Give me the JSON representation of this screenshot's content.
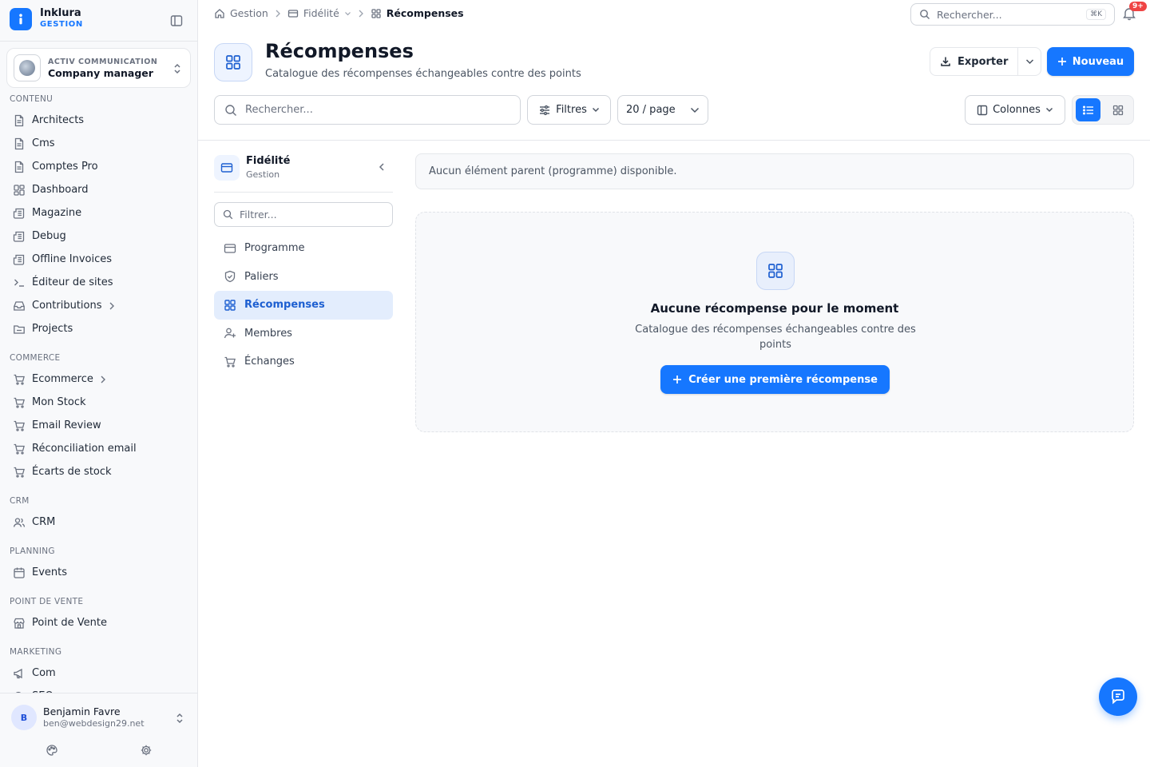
{
  "brand": {
    "name": "Inklura",
    "sub": "GESTION"
  },
  "org": {
    "label": "ACTIV COMMUNICATION",
    "name": "Company manager"
  },
  "sidebar": {
    "sections": [
      {
        "title": "CONTENU",
        "items": [
          {
            "label": "Architects",
            "icon": "file-text-icon"
          },
          {
            "label": "Cms",
            "icon": "file-text-icon"
          },
          {
            "label": "Comptes Pro",
            "icon": "file-text-icon"
          },
          {
            "label": "Dashboard",
            "icon": "dashboard-icon"
          },
          {
            "label": "Magazine",
            "icon": "newspaper-icon"
          },
          {
            "label": "Debug",
            "icon": "newspaper-icon"
          },
          {
            "label": "Offline Invoices",
            "icon": "newspaper-icon"
          },
          {
            "label": "Éditeur de sites",
            "icon": "terminal-icon"
          },
          {
            "label": "Contributions",
            "icon": "inbox-icon",
            "has_children": true
          },
          {
            "label": "Projects",
            "icon": "folder-icon"
          }
        ]
      },
      {
        "title": "COMMERCE",
        "items": [
          {
            "label": "Ecommerce",
            "icon": "cart-icon",
            "has_children": true
          },
          {
            "label": "Mon Stock",
            "icon": "cart-icon"
          },
          {
            "label": "Email Review",
            "icon": "cart-icon"
          },
          {
            "label": "Réconciliation email",
            "icon": "cart-icon"
          },
          {
            "label": "Écarts de stock",
            "icon": "cart-icon"
          }
        ]
      },
      {
        "title": "CRM",
        "items": [
          {
            "label": "CRM",
            "icon": "users-icon"
          }
        ]
      },
      {
        "title": "PLANNING",
        "items": [
          {
            "label": "Events",
            "icon": "calendar-icon"
          }
        ]
      },
      {
        "title": "POINT DE VENTE",
        "items": [
          {
            "label": "Point de Vente",
            "icon": "store-icon"
          }
        ]
      },
      {
        "title": "MARKETING",
        "items": [
          {
            "label": "Com",
            "icon": "megaphone-icon"
          },
          {
            "label": "SEO",
            "icon": "search-icon"
          }
        ]
      }
    ]
  },
  "user": {
    "initial": "B",
    "name": "Benjamin Favre",
    "email": "ben@webdesign29.net"
  },
  "topbar": {
    "breadcrumbs": [
      {
        "label": "Gestion",
        "icon": "home-icon"
      },
      {
        "label": "Fidélité",
        "icon": "card-icon",
        "has_dropdown": true
      },
      {
        "label": "Récompenses",
        "icon": "grid-icon",
        "current": true
      }
    ],
    "search_placeholder": "Rechercher...",
    "search_shortcut": "⌘K",
    "notifications_badge": "9+"
  },
  "page": {
    "title": "Récompenses",
    "subtitle": "Catalogue des récompenses échangeables contre des points",
    "export_label": "Exporter",
    "new_label": "Nouveau"
  },
  "toolbar": {
    "search_placeholder": "Rechercher...",
    "filters_label": "Filtres",
    "per_page_label": "20 / page",
    "columns_label": "Colonnes",
    "view_mode": "list"
  },
  "subnav": {
    "title": "Fidélité",
    "caption": "Gestion",
    "filter_placeholder": "Filtrer...",
    "items": [
      {
        "label": "Programme",
        "icon": "card-icon"
      },
      {
        "label": "Paliers",
        "icon": "shield-icon"
      },
      {
        "label": "Récompenses",
        "icon": "grid-icon",
        "active": true
      },
      {
        "label": "Membres",
        "icon": "user-plus-icon"
      },
      {
        "label": "Échanges",
        "icon": "cart-icon"
      }
    ]
  },
  "main": {
    "notice": "Aucun élément parent (programme) disponible.",
    "empty_title": "Aucune récompense pour le moment",
    "empty_description": "Catalogue des récompenses échangeables contre des points",
    "empty_cta": "Créer une première récompense"
  },
  "colors": {
    "accent": "#1677ff",
    "accent_soft": "#e3edfd",
    "badge": "#ef4444"
  }
}
